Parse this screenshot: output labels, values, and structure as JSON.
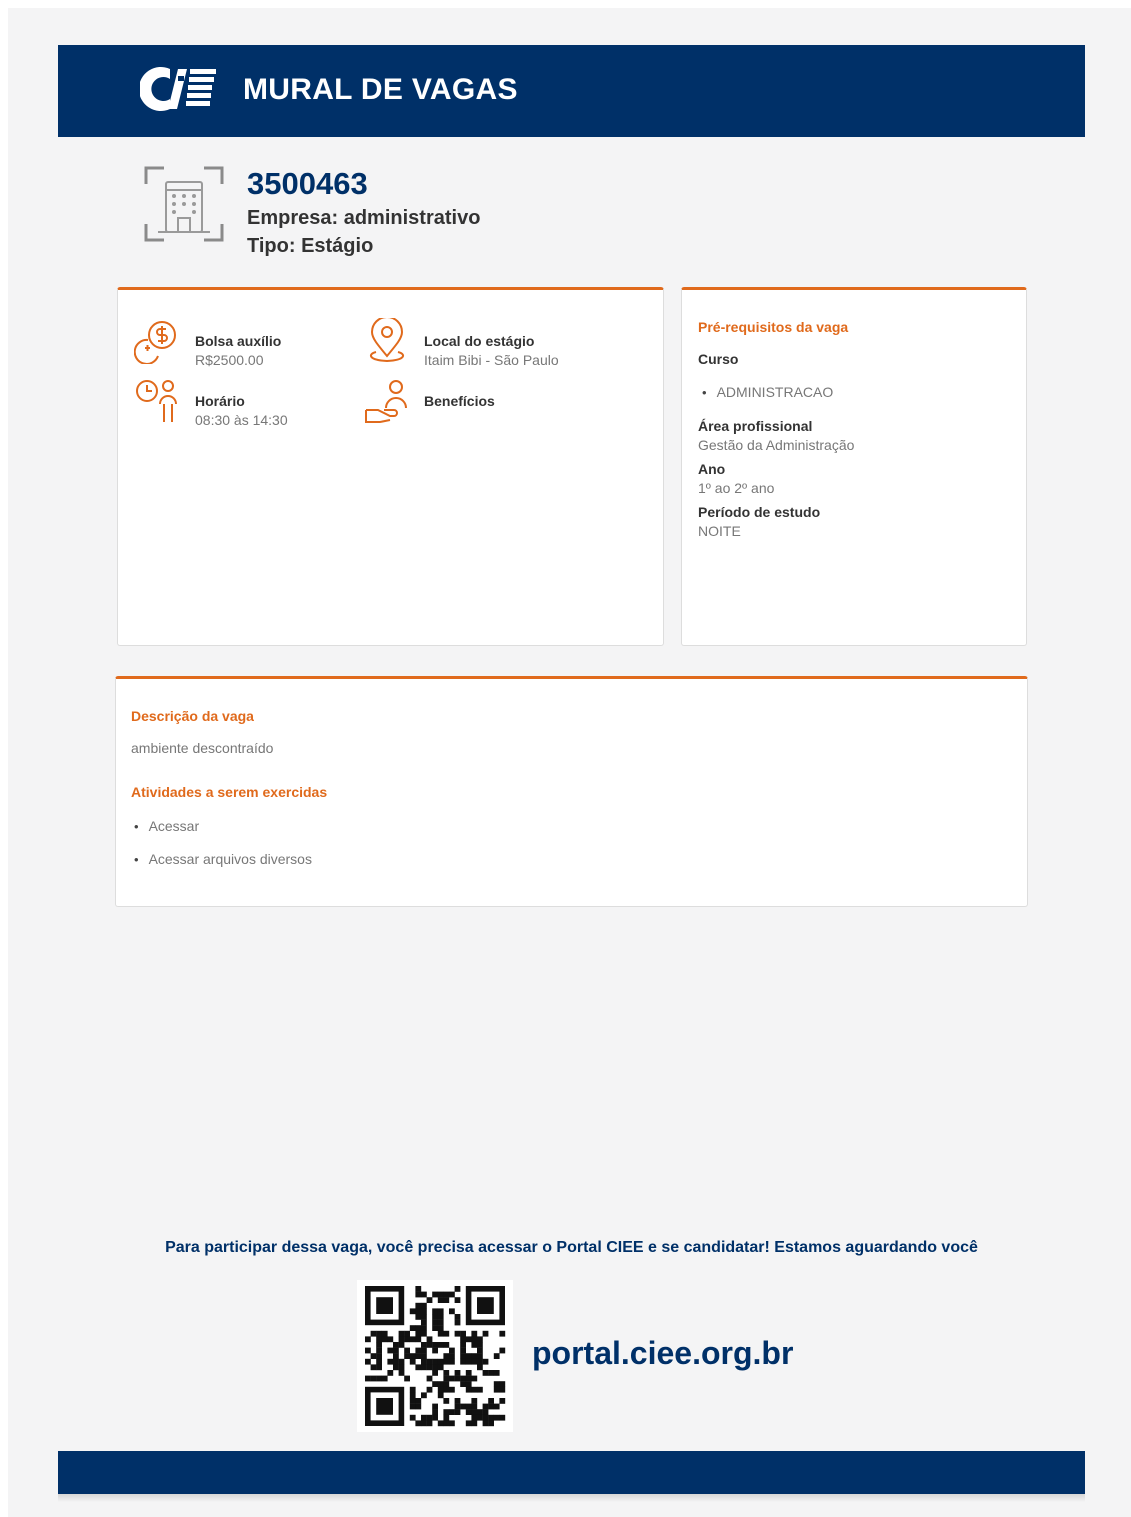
{
  "header": {
    "title": "MURAL DE VAGAS",
    "logo_icon": "ciee-logo-icon"
  },
  "job": {
    "id": "3500463",
    "company": "Empresa: administrativo",
    "type": "Tipo: Estágio"
  },
  "details": {
    "bolsa": {
      "label": "Bolsa auxílio",
      "value": "R$2500.00",
      "icon": "money-icon"
    },
    "local": {
      "label": "Local do estágio",
      "value": "Itaim Bibi - São Paulo",
      "icon": "map-pin-icon"
    },
    "horario": {
      "label": "Horário",
      "value": "08:30 às 14:30",
      "icon": "clock-person-icon"
    },
    "beneficios": {
      "label": "Benefícios",
      "icon": "hand-person-icon"
    }
  },
  "requisitos": {
    "title": "Pré-requisitos da vaga",
    "curso_label": "Curso",
    "cursos": [
      "ADMINISTRACAO"
    ],
    "area_label": "Área profissional",
    "area_value": "Gestão da Administração",
    "ano_label": "Ano",
    "ano_value": "1º ao 2º ano",
    "periodo_label": "Período de estudo",
    "periodo_value": "NOITE"
  },
  "descricao": {
    "title": "Descrição da vaga",
    "text": "ambiente descontraído",
    "atividades_title": "Atividades a serem exercidas",
    "atividades": [
      "Acessar",
      "Acessar arquivos diversos"
    ]
  },
  "cta": {
    "text": "Para participar dessa vaga, você precisa acessar o Portal CIEE e se candidatar! Estamos aguardando você",
    "portal": "portal.ciee.org.br"
  },
  "colors": {
    "navy": "#003068",
    "orange": "#e06a1c",
    "background": "#f4f4f5"
  }
}
